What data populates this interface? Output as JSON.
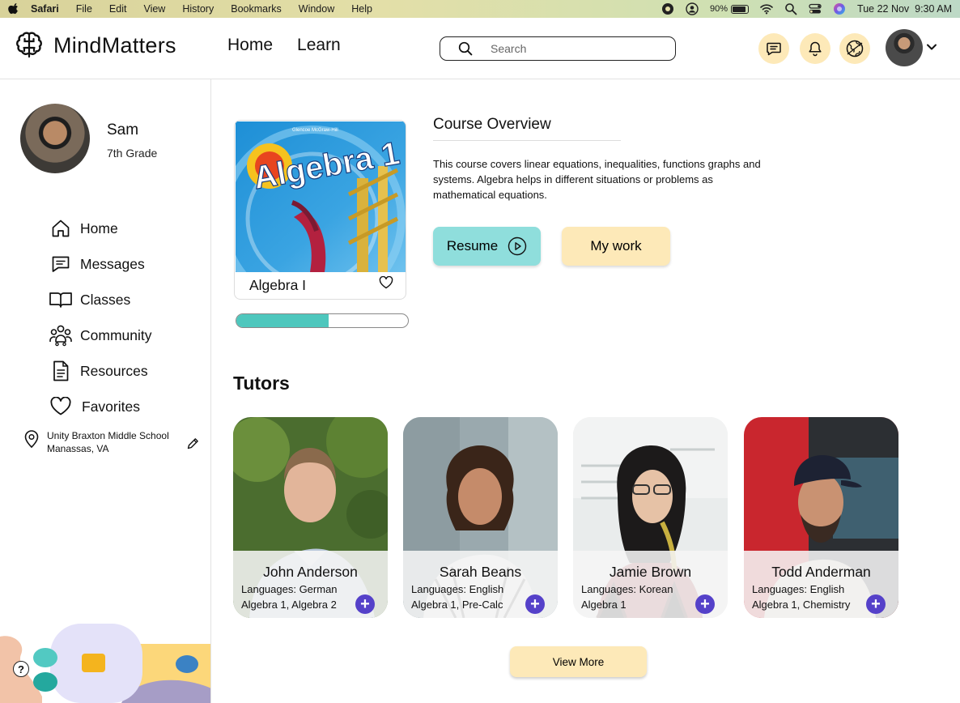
{
  "menubar": {
    "app": "Safari",
    "items": [
      "File",
      "Edit",
      "View",
      "History",
      "Bookmarks",
      "Window",
      "Help"
    ],
    "battery": "90%",
    "datetime": "Tue 22 Nov  9:30 AM"
  },
  "header": {
    "brand": "MindMatters",
    "nav": [
      "Home",
      "Learn"
    ],
    "search_placeholder": "Search"
  },
  "profile": {
    "name": "Sam",
    "grade": "7th Grade"
  },
  "sidebar": {
    "items": [
      {
        "label": "Home",
        "icon": "home-icon"
      },
      {
        "label": "Messages",
        "icon": "message-icon"
      },
      {
        "label": "Classes",
        "icon": "book-icon"
      },
      {
        "label": "Community",
        "icon": "community-icon"
      },
      {
        "label": "Resources",
        "icon": "document-icon"
      },
      {
        "label": "Favorites",
        "icon": "heart-icon"
      }
    ],
    "school_name": "Unity Braxton Middle School",
    "school_location": "Manassas, VA"
  },
  "course": {
    "cover_publisher": "Glencoe McGraw-Hill",
    "cover_title": "Algebra 1",
    "title": "Algebra I",
    "progress": 0.54,
    "overview_title": "Course Overview",
    "overview_text": "This course covers linear equations, inequalities, functions graphs and systems. Algebra helps in different situations or problems as mathematical equations.",
    "resume_label": "Resume",
    "mywork_label": "My work"
  },
  "tutors": {
    "title": "Tutors",
    "list": [
      {
        "name": "John Anderson",
        "languages": "Languages: German",
        "subjects": "Algebra 1, Algebra 2"
      },
      {
        "name": "Sarah Beans",
        "languages": "Languages: English",
        "subjects": "Algebra 1, Pre-Calc"
      },
      {
        "name": "Jamie Brown",
        "languages": "Languages: Korean",
        "subjects": "Algebra 1"
      },
      {
        "name": "Todd Anderman",
        "languages": "Languages: English",
        "subjects": "Algebra 1, Chemistry"
      }
    ],
    "view_more": "View More"
  },
  "colors": {
    "accent_yellow": "#fde9b8",
    "accent_teal": "#8fdedc",
    "progress_teal": "#4ec7bd",
    "add_purple": "#5541c9"
  }
}
